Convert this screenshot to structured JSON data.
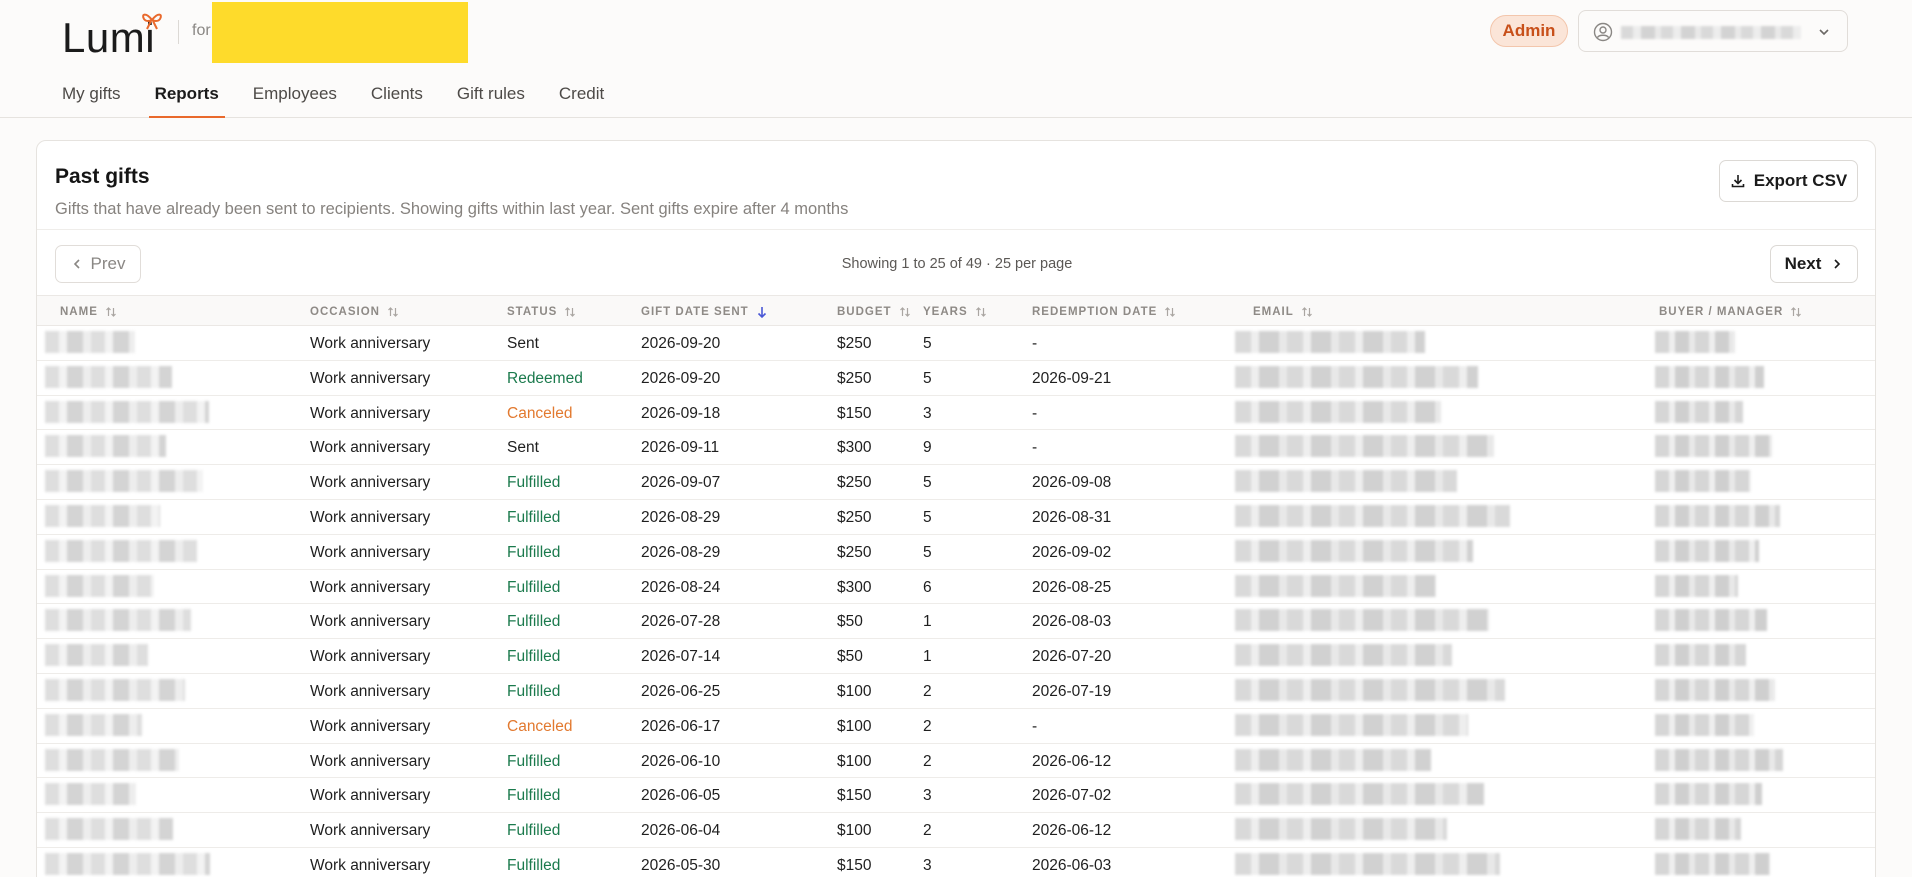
{
  "brand": {
    "name": "Lumi",
    "for_label": "for"
  },
  "header": {
    "admin_badge": "Admin",
    "accent_color": "#e9692c"
  },
  "nav": {
    "tabs": [
      {
        "label": "My gifts",
        "active": false
      },
      {
        "label": "Reports",
        "active": true
      },
      {
        "label": "Employees",
        "active": false
      },
      {
        "label": "Clients",
        "active": false
      },
      {
        "label": "Gift rules",
        "active": false
      },
      {
        "label": "Credit",
        "active": false
      }
    ]
  },
  "card": {
    "title": "Past gifts",
    "subtitle": "Gifts that have already been sent to recipients. Showing gifts within last year. Sent gifts expire after 4 months",
    "export_label": "Export CSV"
  },
  "pagination": {
    "prev_label": "Prev",
    "next_label": "Next",
    "info": "Showing 1 to 25 of 49 · 25 per page"
  },
  "table": {
    "columns": [
      {
        "key": "name",
        "label": "NAME",
        "sort": "none"
      },
      {
        "key": "occasion",
        "label": "OCCASION",
        "sort": "none"
      },
      {
        "key": "status",
        "label": "STATUS",
        "sort": "none"
      },
      {
        "key": "gift_date_sent",
        "label": "GIFT DATE SENT",
        "sort": "desc"
      },
      {
        "key": "budget",
        "label": "BUDGET",
        "sort": "none"
      },
      {
        "key": "years",
        "label": "YEARS",
        "sort": "none"
      },
      {
        "key": "redemption_date",
        "label": "REDEMPTION DATE",
        "sort": "none"
      },
      {
        "key": "email",
        "label": "EMAIL",
        "sort": "none"
      },
      {
        "key": "buyer_manager",
        "label": "BUYER / MANAGER",
        "sort": "none"
      }
    ],
    "rows": [
      {
        "occasion": "Work anniversary",
        "status": "Sent",
        "gift_date_sent": "2026-09-20",
        "budget": "$250",
        "years": "5",
        "redemption_date": "-"
      },
      {
        "occasion": "Work anniversary",
        "status": "Redeemed",
        "gift_date_sent": "2026-09-20",
        "budget": "$250",
        "years": "5",
        "redemption_date": "2026-09-21"
      },
      {
        "occasion": "Work anniversary",
        "status": "Canceled",
        "gift_date_sent": "2026-09-18",
        "budget": "$150",
        "years": "3",
        "redemption_date": "-"
      },
      {
        "occasion": "Work anniversary",
        "status": "Sent",
        "gift_date_sent": "2026-09-11",
        "budget": "$300",
        "years": "9",
        "redemption_date": "-"
      },
      {
        "occasion": "Work anniversary",
        "status": "Fulfilled",
        "gift_date_sent": "2026-09-07",
        "budget": "$250",
        "years": "5",
        "redemption_date": "2026-09-08"
      },
      {
        "occasion": "Work anniversary",
        "status": "Fulfilled",
        "gift_date_sent": "2026-08-29",
        "budget": "$250",
        "years": "5",
        "redemption_date": "2026-08-31"
      },
      {
        "occasion": "Work anniversary",
        "status": "Fulfilled",
        "gift_date_sent": "2026-08-29",
        "budget": "$250",
        "years": "5",
        "redemption_date": "2026-09-02"
      },
      {
        "occasion": "Work anniversary",
        "status": "Fulfilled",
        "gift_date_sent": "2026-08-24",
        "budget": "$300",
        "years": "6",
        "redemption_date": "2026-08-25"
      },
      {
        "occasion": "Work anniversary",
        "status": "Fulfilled",
        "gift_date_sent": "2026-07-28",
        "budget": "$50",
        "years": "1",
        "redemption_date": "2026-08-03"
      },
      {
        "occasion": "Work anniversary",
        "status": "Fulfilled",
        "gift_date_sent": "2026-07-14",
        "budget": "$50",
        "years": "1",
        "redemption_date": "2026-07-20"
      },
      {
        "occasion": "Work anniversary",
        "status": "Fulfilled",
        "gift_date_sent": "2026-06-25",
        "budget": "$100",
        "years": "2",
        "redemption_date": "2026-07-19"
      },
      {
        "occasion": "Work anniversary",
        "status": "Canceled",
        "gift_date_sent": "2026-06-17",
        "budget": "$100",
        "years": "2",
        "redemption_date": "-"
      },
      {
        "occasion": "Work anniversary",
        "status": "Fulfilled",
        "gift_date_sent": "2026-06-10",
        "budget": "$100",
        "years": "2",
        "redemption_date": "2026-06-12"
      },
      {
        "occasion": "Work anniversary",
        "status": "Fulfilled",
        "gift_date_sent": "2026-06-05",
        "budget": "$150",
        "years": "3",
        "redemption_date": "2026-07-02"
      },
      {
        "occasion": "Work anniversary",
        "status": "Fulfilled",
        "gift_date_sent": "2026-06-04",
        "budget": "$100",
        "years": "2",
        "redemption_date": "2026-06-12"
      },
      {
        "occasion": "Work anniversary",
        "status": "Fulfilled",
        "gift_date_sent": "2026-05-30",
        "budget": "$150",
        "years": "3",
        "redemption_date": "2026-06-03"
      }
    ]
  }
}
